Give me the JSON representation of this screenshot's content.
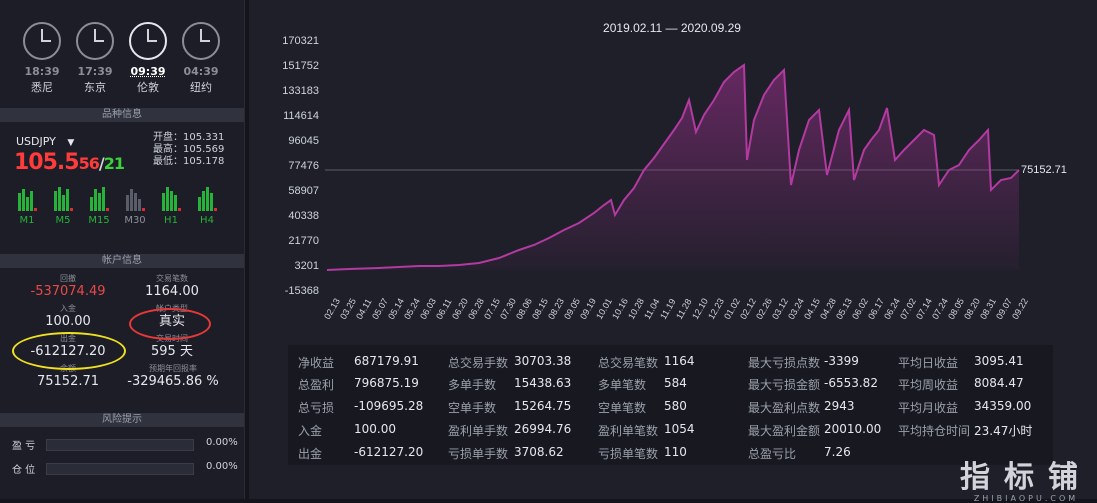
{
  "clocks": [
    {
      "time": "18:39",
      "city": "悉尼",
      "active": false
    },
    {
      "time": "17:39",
      "city": "东京",
      "active": false
    },
    {
      "time": "09:39",
      "city": "伦敦",
      "active": true
    },
    {
      "time": "04:39",
      "city": "纽约",
      "active": false
    }
  ],
  "sections": {
    "product": "品种信息",
    "account": "帐户信息",
    "risk": "风险提示"
  },
  "quote": {
    "symbol": "USDJPY",
    "dropdown_icon": "caret-down-icon",
    "price_main": "105.5",
    "price_pips": "56",
    "slash": "/",
    "spread": "21",
    "open": "开盘：105.331",
    "high": "最高：105.569",
    "low": "最低：105.178"
  },
  "timeframes": [
    {
      "label": "M1",
      "active": true
    },
    {
      "label": "M5",
      "active": true
    },
    {
      "label": "M15",
      "active": true
    },
    {
      "label": "M30",
      "active": false
    },
    {
      "label": "H1",
      "active": true
    },
    {
      "label": "H4",
      "active": true
    }
  ],
  "account": {
    "drawdown_label": "回撤",
    "drawdown_value": "-537074.49",
    "trades_label": "交易笔数",
    "trades_value": "1164.00",
    "deposit_label": "入金",
    "deposit_value": "100.00",
    "type_label": "帐户类型",
    "type_value": "真实",
    "withdraw_label": "出金",
    "withdraw_value": "-612127.20",
    "days_label": "交易时间",
    "days_value": "595 天",
    "balance_label": "余额",
    "balance_value": "75152.71",
    "annual_label": "预期年回报率",
    "annual_value": "-329465.86 %"
  },
  "risk": [
    {
      "label": "盈 亏",
      "value": "0.00%"
    },
    {
      "label": "仓 位",
      "value": "0.00%"
    }
  ],
  "stats": [
    [
      [
        "净收益",
        "687179.91"
      ],
      [
        "总交易手数",
        "30703.38"
      ],
      [
        "总交易笔数",
        "1164"
      ],
      [
        "最大亏损点数",
        "-3399"
      ],
      [
        "平均日收益",
        "3095.41"
      ]
    ],
    [
      [
        "总盈利",
        "796875.19"
      ],
      [
        "多单手数",
        "15438.63"
      ],
      [
        "多单笔数",
        "584"
      ],
      [
        "最大亏损金额",
        "-6553.82"
      ],
      [
        "平均周收益",
        "8084.47"
      ]
    ],
    [
      [
        "总亏损",
        "-109695.28"
      ],
      [
        "空单手数",
        "15264.75"
      ],
      [
        "空单笔数",
        "580"
      ],
      [
        "最大盈利点数",
        "2943"
      ],
      [
        "平均月收益",
        "34359.00"
      ]
    ],
    [
      [
        "入金",
        "100.00"
      ],
      [
        "盈利单手数",
        "26994.76"
      ],
      [
        "盈利单笔数",
        "1054"
      ],
      [
        "最大盈利金额",
        "20010.00"
      ],
      [
        "平均持仓时间",
        "23.47小时"
      ]
    ],
    [
      [
        "出金",
        "-612127.20"
      ],
      [
        "亏损单手数",
        "3708.62"
      ],
      [
        "亏损单笔数",
        "110"
      ],
      [
        "总盈亏比",
        "7.26"
      ],
      [
        "",
        ""
      ]
    ]
  ],
  "watermark": {
    "cn": "指标铺",
    "en": "ZHIBIAOPU.COM"
  },
  "colors": {
    "accent_red": "#ff3b3b",
    "accent_green": "#25b33a",
    "annot_yellow": "#f0e020",
    "annot_red": "#e83838"
  }
}
